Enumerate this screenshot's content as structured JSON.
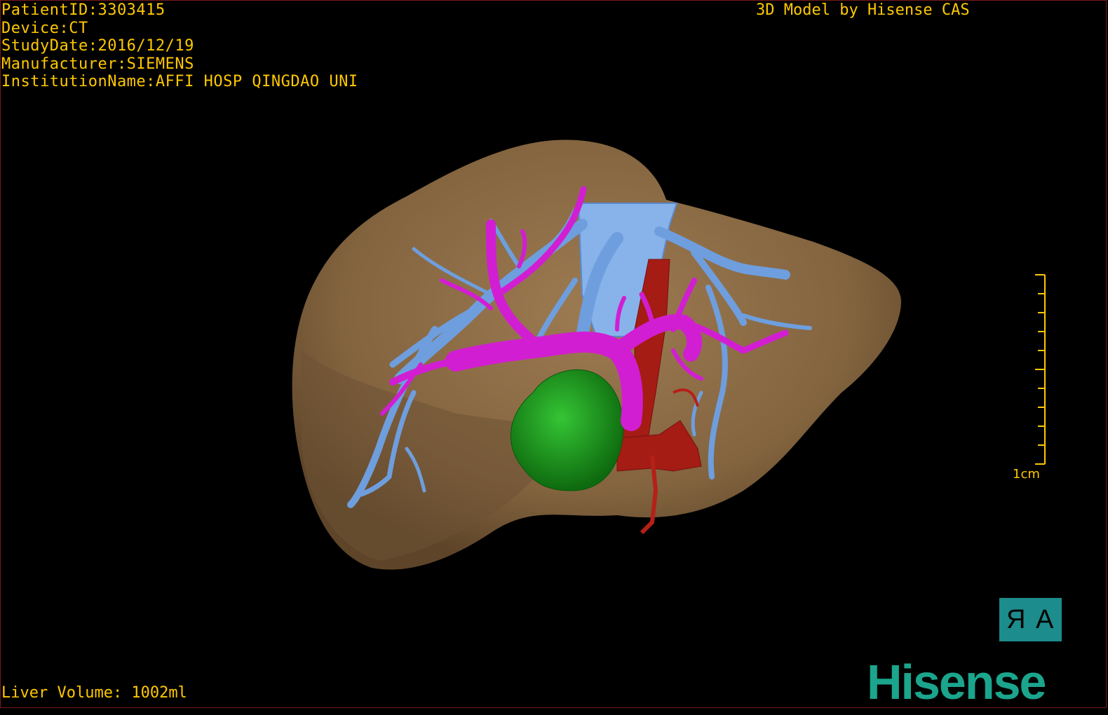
{
  "overlay": {
    "patient_id": "PatientID:3303415",
    "device": "Device:CT",
    "study_date": "StudyDate:2016/12/19",
    "manufacturer": "Manufacturer:SIEMENS",
    "institution": "InstitutionName:AFFI HOSP QINGDAO UNI",
    "credit": "3D Model by Hisense CAS",
    "liver_volume": "Liver Volume: 1002ml"
  },
  "scale": {
    "label": "1cm"
  },
  "orientation": {
    "left_glyph": "R",
    "right_glyph": "A"
  },
  "brand": {
    "name": "Hisense"
  },
  "colors": {
    "text": "#ffc800",
    "liver": "#8a6a44",
    "portal_vein": "#d21ed2",
    "hepatic_vein": "#6e9ede",
    "artery": "#a41c14",
    "tumor": "#1a9a1a",
    "brand": "#1aa58c",
    "orientation_cube": "#1c8c8c"
  },
  "icons": [
    "orientation-cube-icon",
    "scale-bar-icon",
    "brand-logo"
  ]
}
